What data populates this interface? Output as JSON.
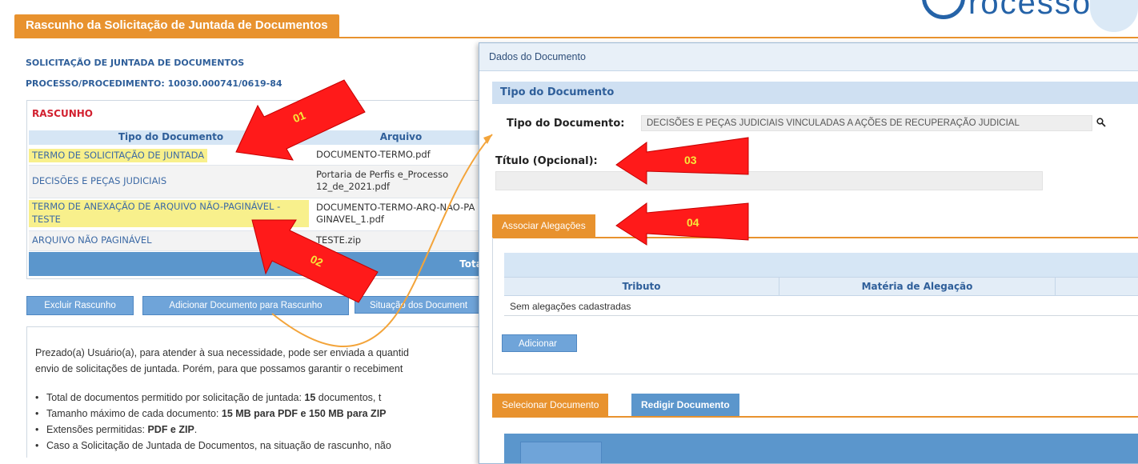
{
  "page": {
    "title": "Rascunho da Solicitação de Juntada de Documentos",
    "subtitle": "SOLICITAÇÃO DE JUNTADA DE DOCUMENTOS",
    "process": "PROCESSO/PROCEDIMENTO: 10030.000741/0619-84"
  },
  "logo": {
    "text": "rocesso"
  },
  "draft": {
    "label": "RASCUNHO",
    "columns": [
      "Tipo do Documento",
      "Arquivo"
    ],
    "rows": [
      {
        "tipo": "TERMO DE SOLICITAÇÃO DE JUNTADA",
        "arquivo": "DOCUMENTO-TERMO.pdf"
      },
      {
        "tipo": "DECISÕES E PEÇAS JUDICIAIS",
        "arquivo": "Portaria de Perfis e_Processo 12_de_2021.pdf"
      },
      {
        "tipo": "TERMO DE ANEXAÇÃO DE ARQUIVO NÃO-PAGINÁVEL - TESTE",
        "arquivo": "DOCUMENTO-TERMO-ARQ-NAO-PAGINAVEL_1.pdf"
      },
      {
        "tipo": "ARQUIVO NÃO PAGINÁVEL",
        "arquivo": "TESTE.zip"
      }
    ],
    "total_label": "Total"
  },
  "buttons": {
    "delete_draft": "Excluir Rascunho",
    "add_document": "Adicionar Documento para Rascunho",
    "document_status": "Situação dos Document"
  },
  "info": {
    "line1": "Prezado(a) Usuário(a), para atender à sua necessidade, pode ser enviada a quantid",
    "line2": "envio de solicitações de juntada. Porém, para que possamos garantir o recebiment",
    "bullets": [
      {
        "pre": "Total de documentos permitido por solicitação de juntada: ",
        "bold": "15",
        "post": " documentos, t"
      },
      {
        "pre": "Tamanho máximo de cada documento: ",
        "bold": "15 MB para PDF e 150 MB para ZIP",
        "post": ""
      },
      {
        "pre": "Extensões permitidas: ",
        "bold": "PDF e ZIP",
        "post": "."
      },
      {
        "pre": "Caso a Solicitação de Juntada de Documentos, na situação de rascunho, não",
        "bold": "",
        "post": ""
      }
    ]
  },
  "modal": {
    "title": "Dados do Documento",
    "section_tipo": "Tipo do Documento",
    "tipo_label": "Tipo do Documento:",
    "tipo_value": "DECISÕES E PEÇAS JUDICIAIS VINCULADAS A AÇÕES DE RECUPERAÇÃO JUDICIAL",
    "titulo_label": "Título (Opcional):",
    "tab_associar": "Associar Alegações",
    "aleg_columns": [
      "Tributo",
      "Matéria de Alegação"
    ],
    "aleg_empty": "Sem alegações cadastradas",
    "add_button": "Adicionar",
    "tab_selecionar": "Selecionar Documento",
    "tab_redigir": "Redigir Documento"
  },
  "annotations": [
    "01",
    "02",
    "03",
    "04"
  ],
  "colors": {
    "orange": "#e8922e",
    "blue": "#5b96cc",
    "highlight": "#f8f08c",
    "arrow": "#ff1a1a"
  }
}
